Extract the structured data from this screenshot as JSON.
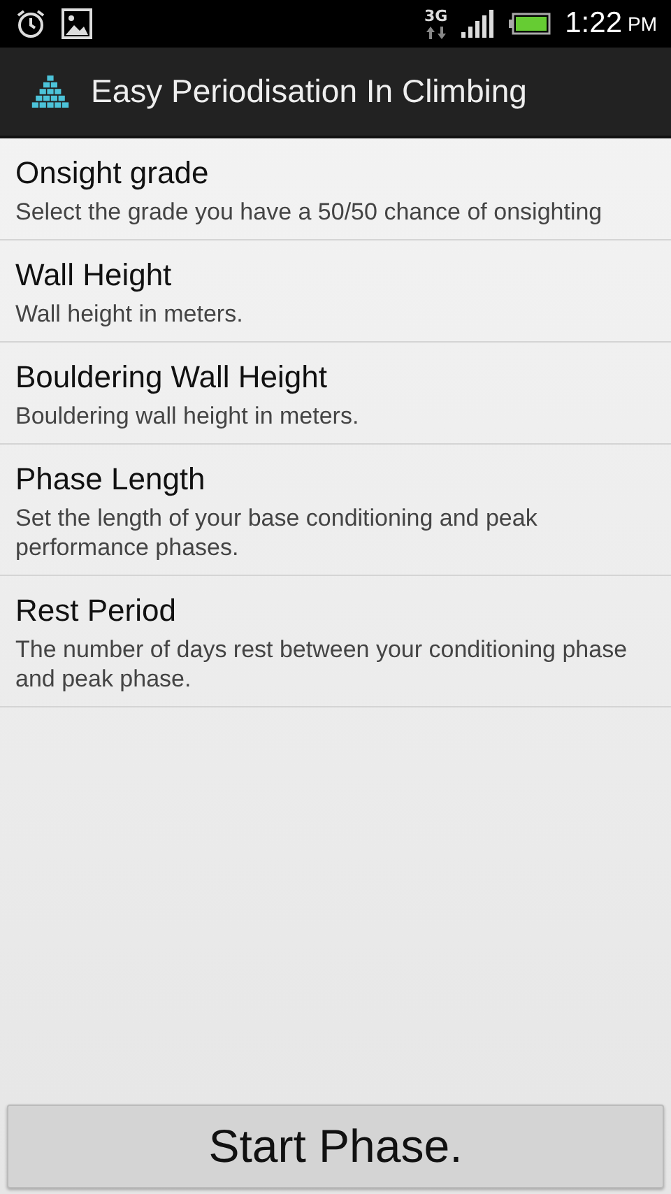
{
  "status_bar": {
    "network": "3G",
    "time": "1:22",
    "period": "PM"
  },
  "action_bar": {
    "title": "Easy Periodisation In Climbing"
  },
  "preferences": [
    {
      "title": "Onsight grade",
      "summary": "Select the grade you have a 50/50 chance of onsighting"
    },
    {
      "title": "Wall Height",
      "summary": "Wall height in meters."
    },
    {
      "title": "Bouldering Wall Height",
      "summary": "Bouldering wall height in meters."
    },
    {
      "title": "Phase Length",
      "summary": "Set the length of your base conditioning and peak performance phases."
    },
    {
      "title": "Rest Period",
      "summary": "The number of days rest between your conditioning phase and peak phase."
    }
  ],
  "button": {
    "label": "Start Phase."
  }
}
